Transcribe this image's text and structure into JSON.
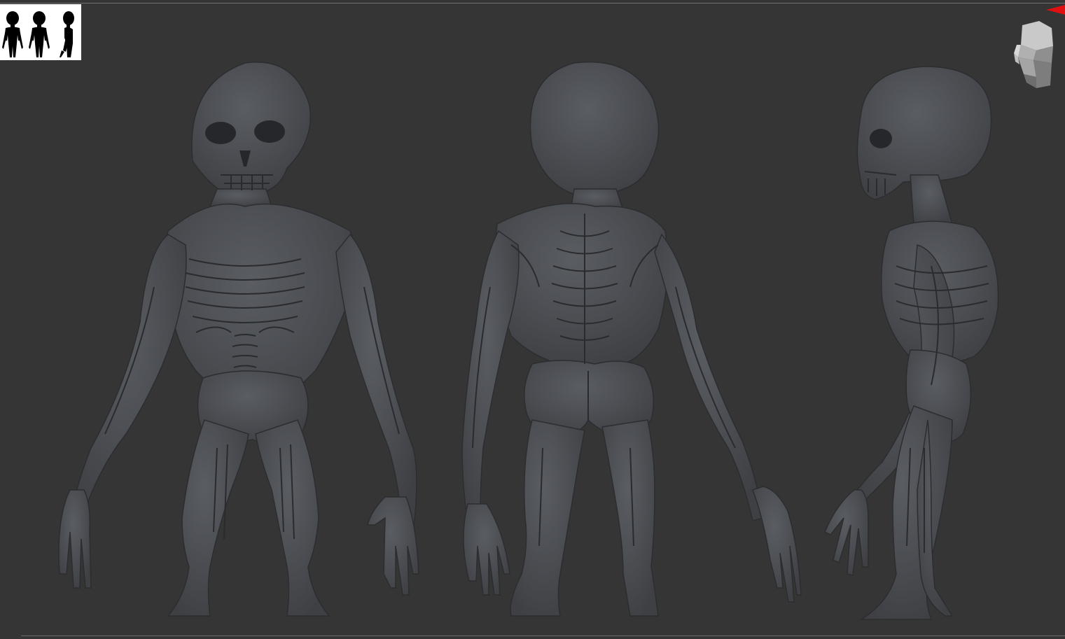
{
  "viewport": {
    "background_color": "#353535",
    "model_color": "#4a4c50"
  },
  "thumbnail": {
    "icon": "silhouette-thumbnail-icon",
    "views": [
      "front",
      "back",
      "side"
    ]
  },
  "navigation": {
    "icon": "head-navigation-cube-icon",
    "marker_icon": "red-axis-marker-icon",
    "marker_color": "#e01010"
  },
  "figures": [
    {
      "view": "front",
      "icon": "creature-front-view"
    },
    {
      "view": "back",
      "icon": "creature-back-view"
    },
    {
      "view": "side",
      "icon": "creature-side-view"
    }
  ]
}
